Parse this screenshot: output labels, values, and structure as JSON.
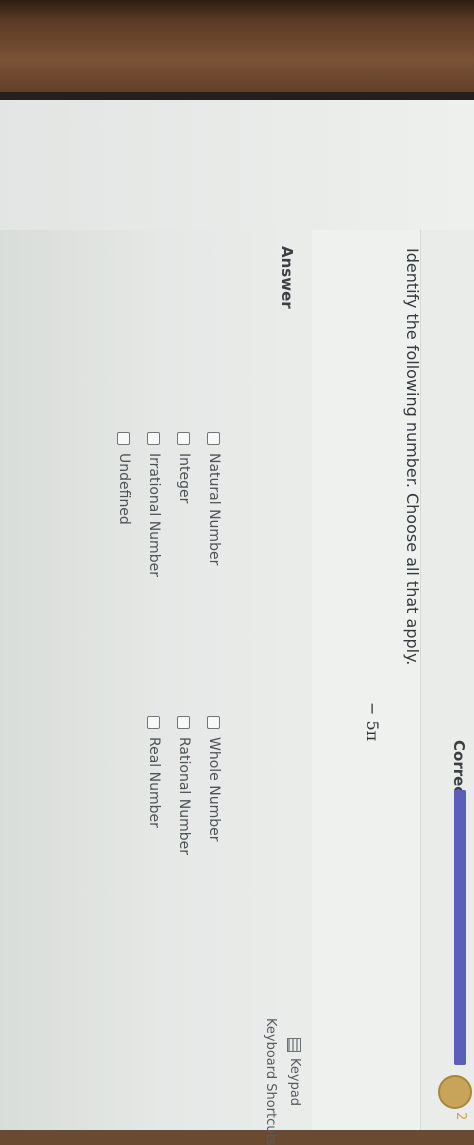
{
  "header": {
    "status_text": "Correct",
    "progress_fraction": 0.9,
    "badge_number": "2"
  },
  "question": {
    "prompt": "Identify the following number. Choose all that apply.",
    "expression": "− 5π"
  },
  "answer": {
    "label": "Answer",
    "options": [
      "Natural Number",
      "Integer",
      "Irrational Number",
      "Undefined",
      "Whole Number",
      "Rational Number",
      "Real Number"
    ]
  },
  "tools": {
    "keypad_label": "Keypad",
    "shortcuts_label": "Keyboard Shortcuts"
  }
}
